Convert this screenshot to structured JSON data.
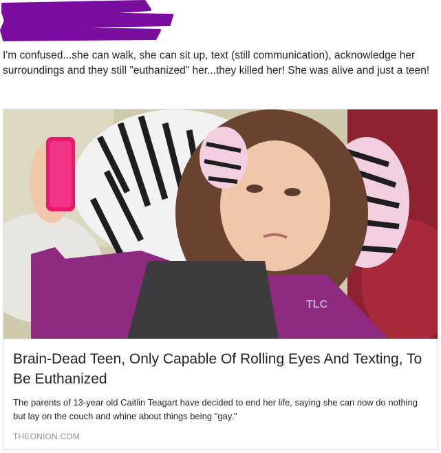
{
  "post": {
    "text": "I'm confused...she can walk, she can sit up, text (still communication), acknowledge her surroundings and they still \"euthanized\" her...they killed her! She was alive and just a teen!",
    "redaction_color": "#7b0ca0"
  },
  "link_card": {
    "headline": "Brain-Dead Teen, Only Capable Of Rolling Eyes And Texting, To Be Euthanized",
    "summary": "The parents of 13-year old Caitlin Teagart have decided to end her life, saying she can now do nothing but lay on the couch and whine about things being \"gay.\"",
    "source": "THEONION.COM",
    "image_watermark": "TLC"
  }
}
